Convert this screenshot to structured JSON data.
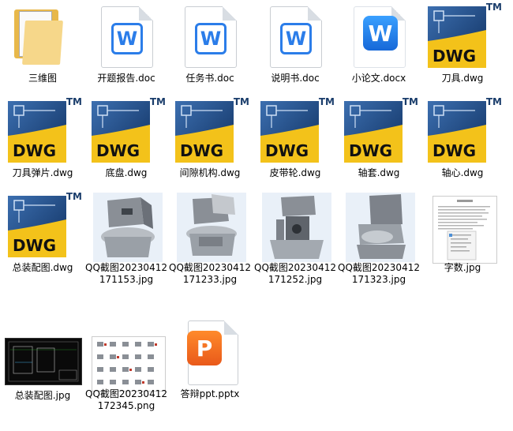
{
  "files": [
    {
      "label": "三维图",
      "icon": "folder-icon"
    },
    {
      "label": "开题报告.doc",
      "icon": "wps-doc-icon"
    },
    {
      "label": "任务书.doc",
      "icon": "wps-doc-icon"
    },
    {
      "label": "说明书.doc",
      "icon": "wps-doc-icon"
    },
    {
      "label": "小论文.docx",
      "icon": "wps-app-icon"
    },
    {
      "label": "刀具.dwg",
      "icon": "dwg-icon"
    },
    {
      "label": "刀具弹片.dwg",
      "icon": "dwg-icon"
    },
    {
      "label": "底盘.dwg",
      "icon": "dwg-icon"
    },
    {
      "label": "间隙机构.dwg",
      "icon": "dwg-icon"
    },
    {
      "label": "皮带轮.dwg",
      "icon": "dwg-icon"
    },
    {
      "label": "轴套.dwg",
      "icon": "dwg-icon"
    },
    {
      "label": "轴心.dwg",
      "icon": "dwg-icon"
    },
    {
      "label": "总装配图.dwg",
      "icon": "dwg-icon"
    },
    {
      "label": "QQ截图20230412171153.jpg",
      "icon": "image-thumbnail"
    },
    {
      "label": "QQ截图20230412171233.jpg",
      "icon": "image-thumbnail"
    },
    {
      "label": "QQ截图20230412171252.jpg",
      "icon": "image-thumbnail"
    },
    {
      "label": "QQ截图20230412171323.jpg",
      "icon": "image-thumbnail"
    },
    {
      "label": "字数.jpg",
      "icon": "image-thumbnail"
    },
    {
      "label": "总装配图.jpg",
      "icon": "image-thumbnail"
    },
    {
      "label": "QQ截图20230412172345.png",
      "icon": "image-thumbnail"
    },
    {
      "label": "答辩ppt.pptx",
      "icon": "ppt-icon"
    }
  ],
  "icon_text": {
    "wps_letter": "W",
    "ppt_letter": "P",
    "dwg_text": "DWG",
    "tm": "TM"
  },
  "colors": {
    "dwg_blue": "#1f4e8c",
    "dwg_yellow": "#f3c21a",
    "wps_blue": "#2b7de9",
    "ppt_orange": "#f07424"
  }
}
